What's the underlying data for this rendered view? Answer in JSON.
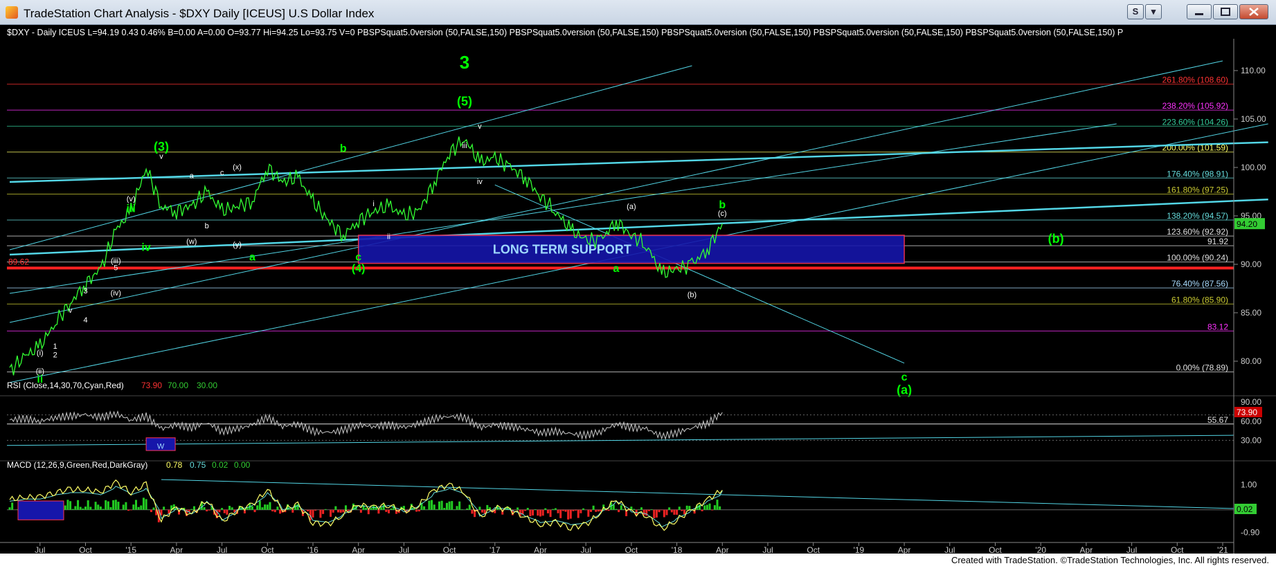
{
  "window": {
    "title": "TradeStation Chart Analysis - $DXY Daily [ICEUS] U.S Dollar Index",
    "buttons": [
      "S",
      "▾"
    ]
  },
  "colors": {
    "background": "#000000",
    "price": "#33ff33",
    "wave_label": "#00ff00",
    "support_box": "#1616aa",
    "support_edge": "#ff3355",
    "trendline": "#53d6e6",
    "rsi": "#c8c8c8",
    "macd": "#ffff66"
  },
  "header_line": "$DXY - Daily  ICEUS  L=94.19  0.43  0.46%  B=0.00  A=0.00  O=93.77  Hi=94.25  Lo=93.75  V=0  PBSPSquat5.0version (50,FALSE,150)   PBSPSquat5.0version (50,FALSE,150)   PBSPSquat5.0version (50,FALSE,150)   PBSPSquat5.0version (50,FALSE,150)   PBSPSquat5.0version (50,FALSE,150)   P",
  "price_axis": {
    "ticks": [
      "110.00",
      "105.00",
      "100.00",
      "95.00",
      "90.00",
      "85.00",
      "80.00"
    ],
    "last": "94.20"
  },
  "fib_levels": [
    {
      "label": "261.80% (108.60)",
      "value": 108.6,
      "color": "#ff3333"
    },
    {
      "label": "238.20% (105.92)",
      "value": 105.92,
      "color": "#ff33ff"
    },
    {
      "label": "223.60% (104.26)",
      "value": 104.26,
      "color": "#33cc99"
    },
    {
      "label": "200.00% (101.59)",
      "value": 101.59,
      "color": "#ffff66"
    },
    {
      "label": "176.40% (98.91)",
      "value": 98.91,
      "color": "#66dddd"
    },
    {
      "label": "161.80% (97.25)",
      "value": 97.25,
      "color": "#cccc33"
    },
    {
      "label": "138.20% (94.57)",
      "value": 94.57,
      "color": "#66dddd"
    },
    {
      "label": "123.60% (92.92)",
      "value": 92.92,
      "color": "#e0e0e0"
    },
    {
      "label": "91.92",
      "value": 91.92,
      "color": "#e0e0e0"
    },
    {
      "label": "100.00% (90.24)",
      "value": 90.24,
      "color": "#e0e0e0"
    },
    {
      "label": "76.40% (87.56)",
      "value": 87.56,
      "color": "#aaddff"
    },
    {
      "label": "61.80% (85.90)",
      "value": 85.9,
      "color": "#cccc33"
    },
    {
      "label": "83.12",
      "value": 83.12,
      "color": "#ff33ff"
    },
    {
      "label": "0.00% (78.89)",
      "value": 78.89,
      "color": "#e0e0e0"
    }
  ],
  "left_level": {
    "label": "89.62",
    "value": 89.62
  },
  "support_box": {
    "label": "LONG TERM SUPPORT",
    "from": "Apr 2016",
    "to": "Apr 2019",
    "low": 90.1,
    "high": 93.0
  },
  "wave_labels": [
    {
      "text": "3",
      "date": "Nov 2016",
      "price": 110.2,
      "color": "#00ff00",
      "size": "xl"
    },
    {
      "text": "(5)",
      "date": "Nov 2016",
      "price": 106.4,
      "color": "#00ff00",
      "size": "l"
    },
    {
      "text": "(3)",
      "date": "Mar 2015",
      "price": 101.7,
      "color": "#00ff00",
      "size": "l"
    },
    {
      "text": "b",
      "date": "Mar 2016",
      "price": 101.6,
      "color": "#00ff00",
      "size": "m"
    },
    {
      "text": "iii",
      "date": "Jan 2015",
      "price": 95.4,
      "color": "#00ff00",
      "size": "m"
    },
    {
      "text": "iv",
      "date": "Feb 2015",
      "price": 91.4,
      "color": "#00ff00",
      "size": "m"
    },
    {
      "text": "a",
      "date": "Sep 2015",
      "price": 90.4,
      "color": "#00ff00",
      "size": "m"
    },
    {
      "text": "c",
      "date": "Apr 2016",
      "price": 90.4,
      "color": "#00ff00",
      "size": "m"
    },
    {
      "text": "(4)",
      "date": "Apr 2016",
      "price": 89.2,
      "color": "#00ff00",
      "size": "m"
    },
    {
      "text": "a",
      "date": "Sep 2017",
      "price": 89.2,
      "color": "#00ff00",
      "size": "m"
    },
    {
      "text": "b",
      "date": "Apr 2018",
      "price": 95.8,
      "color": "#00ff00",
      "size": "m"
    },
    {
      "text": "(b)",
      "date": "Feb 2020",
      "price": 92.2,
      "color": "#00ff00",
      "size": "l"
    },
    {
      "text": "c",
      "date": "Apr 2019",
      "price": 78.0,
      "color": "#00ff00",
      "size": "m"
    },
    {
      "text": "(a)",
      "date": "Apr 2019",
      "price": 76.6,
      "color": "#00ff00",
      "size": "l"
    },
    {
      "text": "ii",
      "date": "Jul 2014",
      "price": 77.8,
      "color": "#00ff00",
      "size": "m"
    },
    {
      "text": "iii",
      "date": "Nov 2016",
      "price": 102.0,
      "color": "#ffffff",
      "size": "s"
    },
    {
      "text": "iv",
      "date": "Dec 2016",
      "price": 98.3,
      "color": "#ffffff",
      "size": "s"
    },
    {
      "text": "v",
      "date": "Dec 2016",
      "price": 104.0,
      "color": "#ffffff",
      "size": "s"
    },
    {
      "text": "i",
      "date": "May 2016",
      "price": 96.0,
      "color": "#ffffff",
      "size": "s"
    },
    {
      "text": "ii",
      "date": "Jun 2016",
      "price": 92.6,
      "color": "#ffffff",
      "size": "s"
    },
    {
      "text": "v",
      "date": "Mar 2015",
      "price": 100.9,
      "color": "#ffffff",
      "size": "s"
    },
    {
      "text": "(v)",
      "date": "Jan 2015",
      "price": 96.5,
      "color": "#ffffff",
      "size": "s"
    },
    {
      "text": "a",
      "date": "May 2015",
      "price": 98.9,
      "color": "#ffffff",
      "size": "s"
    },
    {
      "text": "b",
      "date": "Jun 2015",
      "price": 93.7,
      "color": "#ffffff",
      "size": "s"
    },
    {
      "text": "c",
      "date": "Jul 2015",
      "price": 99.2,
      "color": "#ffffff",
      "size": "s"
    },
    {
      "text": "(x)",
      "date": "Aug 2015",
      "price": 99.8,
      "color": "#ffffff",
      "size": "s"
    },
    {
      "text": "(w)",
      "date": "May 2015",
      "price": 92.1,
      "color": "#ffffff",
      "size": "s"
    },
    {
      "text": "(y)",
      "date": "Aug 2015",
      "price": 91.8,
      "color": "#ffffff",
      "size": "s"
    },
    {
      "text": "(iii)",
      "date": "Dec 2014",
      "price": 90.1,
      "color": "#ffffff",
      "size": "s"
    },
    {
      "text": "5",
      "date": "Dec 2014",
      "price": 89.4,
      "color": "#ffffff",
      "size": "s"
    },
    {
      "text": "(iv)",
      "date": "Dec 2014",
      "price": 86.8,
      "color": "#ffffff",
      "size": "s"
    },
    {
      "text": "3",
      "date": "Oct 2014",
      "price": 87.0,
      "color": "#ffffff",
      "size": "s"
    },
    {
      "text": "v",
      "date": "Sep 2014",
      "price": 85.0,
      "color": "#ffffff",
      "size": "s"
    },
    {
      "text": "4",
      "date": "Oct 2014",
      "price": 84.0,
      "color": "#ffffff",
      "size": "s"
    },
    {
      "text": "1",
      "date": "Aug 2014",
      "price": 81.3,
      "color": "#ffffff",
      "size": "s"
    },
    {
      "text": "2",
      "date": "Aug 2014",
      "price": 80.4,
      "color": "#ffffff",
      "size": "s"
    },
    {
      "text": "(i)",
      "date": "Jul 2014",
      "price": 80.6,
      "color": "#ffffff",
      "size": "s"
    },
    {
      "text": "(ii)",
      "date": "Jul 2014",
      "price": 78.7,
      "color": "#ffffff",
      "size": "s"
    },
    {
      "text": "(a)",
      "date": "Oct 2017",
      "price": 95.7,
      "color": "#ffffff",
      "size": "s"
    },
    {
      "text": "(b)",
      "date": "Feb 2018",
      "price": 86.6,
      "color": "#ffffff",
      "size": "s"
    },
    {
      "text": "(c)",
      "date": "Apr 2018",
      "price": 95.0,
      "color": "#ffffff",
      "size": "s"
    }
  ],
  "rsi": {
    "header": "RSI (Close,14,30,70,Cyan,Red)",
    "value": "73.90",
    "overbought": "70.00",
    "oversold": "30.00",
    "ticks": [
      "90.00",
      "60.00",
      "30.00"
    ],
    "level_label": "55.67",
    "box_label": "W"
  },
  "macd": {
    "header": "MACD (12,26,9,Green,Red,DarkGray)",
    "macd": "0.78",
    "signal": "0.75",
    "diff": "0.02",
    "zero": "0.00",
    "ticks": [
      "1.00",
      "-0.90"
    ],
    "last": "0.02"
  },
  "time_axis": [
    "Jul",
    "Oct",
    "'15",
    "Apr",
    "Jul",
    "Oct",
    "'16",
    "Apr",
    "Jul",
    "Oct",
    "'17",
    "Apr",
    "Jul",
    "Oct",
    "'18",
    "Apr",
    "Jul",
    "Oct",
    "'19",
    "Apr",
    "Jul",
    "Oct",
    "'20",
    "Apr",
    "Jul",
    "Oct",
    "'21"
  ],
  "footer": "Created with TradeStation. ©TradeStation Technologies, Inc. All rights reserved.",
  "chart_data": {
    "type": "line",
    "x_unit": "month",
    "y_unit": "index points",
    "ylim": [
      76.5,
      112
    ],
    "x": [
      "May 2014",
      "Jul 2014",
      "Aug 2014",
      "Sep 2014",
      "Oct 2014",
      "Nov 2014",
      "Dec 2014",
      "Jan 2015",
      "Feb 2015",
      "Mar 2015",
      "Apr 2015",
      "May 2015",
      "Jun 2015",
      "Jul 2015",
      "Aug 2015",
      "Sep 2015",
      "Oct 2015",
      "Nov 2015",
      "Dec 2015",
      "Jan 2016",
      "Feb 2016",
      "Mar 2016",
      "Apr 2016",
      "May 2016",
      "Jun 2016",
      "Jul 2016",
      "Aug 2016",
      "Sep 2016",
      "Oct 2016",
      "Nov 2016",
      "Dec 2016",
      "Jan 2017",
      "Feb 2017",
      "Mar 2017",
      "Apr 2017",
      "May 2017",
      "Jun 2017",
      "Jul 2017",
      "Aug 2017",
      "Sep 2017",
      "Oct 2017",
      "Nov 2017",
      "Dec 2017",
      "Jan 2018",
      "Feb 2018",
      "Mar 2018",
      "Apr 2018",
      "May 2018"
    ],
    "series": [
      {
        "values": [
          79.0,
          80.5,
          81.5,
          84.0,
          86.0,
          88.0,
          89.5,
          93.5,
          95.5,
          100.0,
          96.0,
          95.5,
          96.0,
          97.5,
          95.5,
          96.0,
          96.5,
          100.0,
          98.5,
          99.0,
          96.5,
          94.5,
          93.0,
          94.5,
          95.5,
          96.0,
          95.0,
          95.5,
          98.5,
          101.5,
          103.0,
          100.5,
          101.0,
          100.0,
          99.0,
          97.0,
          95.5,
          93.5,
          92.5,
          92.5,
          94.5,
          93.0,
          92.0,
          89.0,
          89.5,
          90.0,
          91.5,
          94.2
        ]
      },
      {
        "name": "RSI",
        "values": [
          62,
          64,
          60,
          66,
          68,
          70,
          66,
          72,
          62,
          68,
          48,
          54,
          50,
          58,
          44,
          48,
          54,
          66,
          52,
          56,
          44,
          42,
          46,
          54,
          52,
          54,
          50,
          56,
          64,
          68,
          66,
          50,
          54,
          52,
          48,
          42,
          44,
          40,
          38,
          44,
          56,
          50,
          48,
          36,
          42,
          50,
          56,
          73.9
        ]
      },
      {
        "name": "MACD",
        "values": [
          0.4,
          0.5,
          0.5,
          0.7,
          0.8,
          0.8,
          0.7,
          1.1,
          0.7,
          1.0,
          -0.4,
          0.1,
          -0.2,
          0.4,
          -0.5,
          0.0,
          0.2,
          0.8,
          0.0,
          0.2,
          -0.5,
          -0.6,
          -0.2,
          0.2,
          0.1,
          0.2,
          -0.1,
          0.2,
          0.8,
          1.0,
          0.7,
          -0.3,
          0.1,
          0.0,
          -0.3,
          -0.6,
          -0.5,
          -0.7,
          -0.6,
          -0.1,
          0.4,
          -0.1,
          -0.2,
          -0.8,
          -0.4,
          0.0,
          0.4,
          0.78
        ]
      }
    ]
  }
}
